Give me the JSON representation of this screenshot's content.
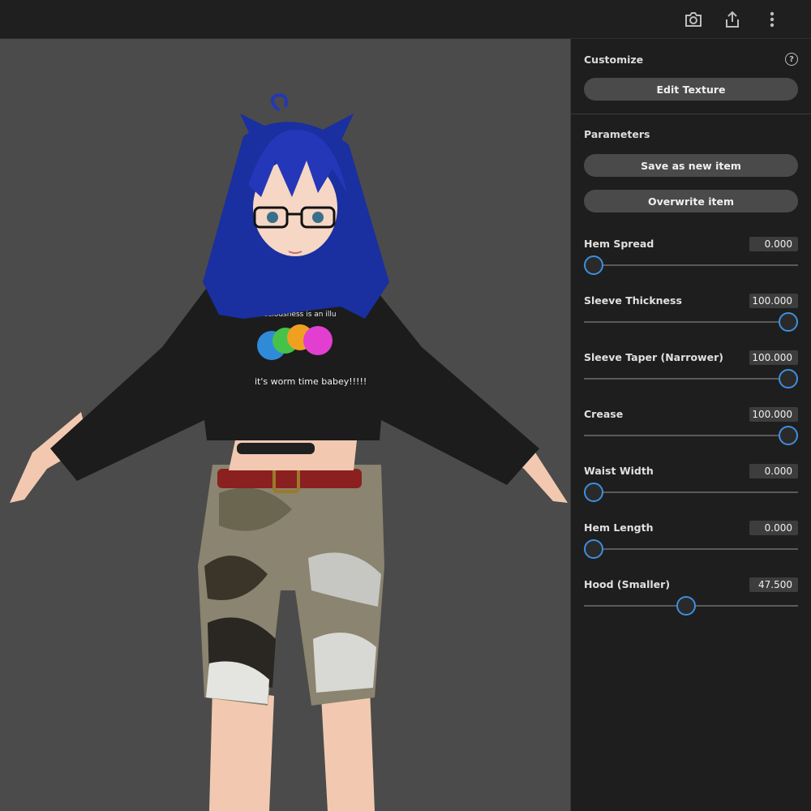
{
  "topbar": {
    "icons": [
      "camera-icon",
      "share-icon",
      "more-vertical-icon"
    ]
  },
  "panel": {
    "customize_title": "Customize",
    "help_glyph": "?",
    "edit_texture_label": "Edit Texture",
    "parameters_title": "Parameters",
    "save_new_label": "Save as new item",
    "overwrite_label": "Overwrite item",
    "params": [
      {
        "name": "Hem Spread",
        "value": "0.000",
        "fraction": 0.0
      },
      {
        "name": "Sleeve Thickness",
        "value": "100.000",
        "fraction": 1.0
      },
      {
        "name": "Sleeve Taper (Narrower)",
        "value": "100.000",
        "fraction": 1.0
      },
      {
        "name": "Crease",
        "value": "100.000",
        "fraction": 1.0
      },
      {
        "name": "Waist Width",
        "value": "0.000",
        "fraction": 0.0
      },
      {
        "name": "Hem Length",
        "value": "0.000",
        "fraction": 0.0
      },
      {
        "name": "Hood (Smaller)",
        "value": "47.500",
        "fraction": 0.475
      }
    ],
    "accent_color": "#3d8fe0"
  },
  "viewport": {
    "shirt_text_top": "nsciousness is an illu",
    "shirt_text_bottom": "it's worm time babey!!!!!"
  }
}
